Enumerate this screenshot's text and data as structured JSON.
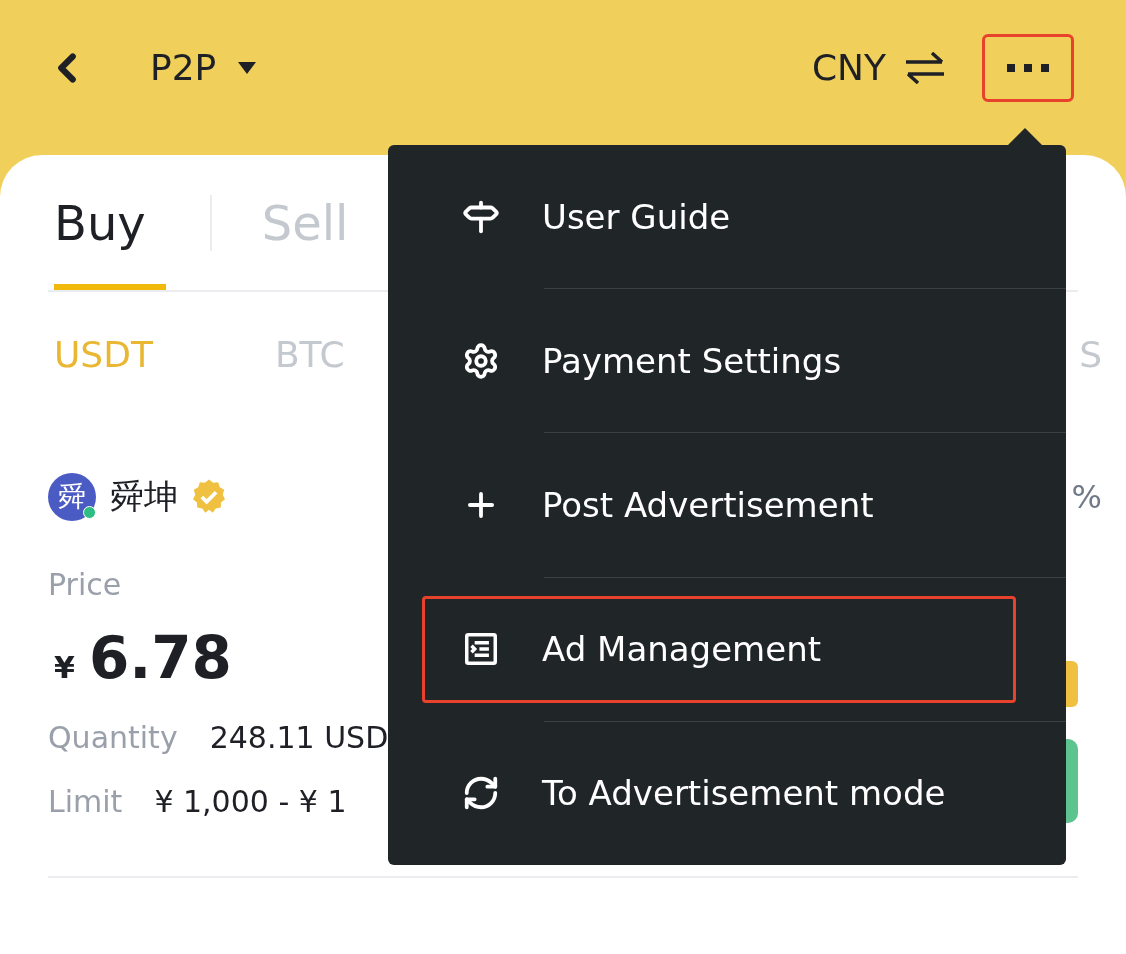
{
  "header": {
    "title": "P2P",
    "currency": "CNY",
    "more_highlighted": true
  },
  "trade_tabs": [
    {
      "label": "Buy",
      "selected": true
    },
    {
      "label": "Sell",
      "selected": false
    }
  ],
  "coin_tabs": [
    {
      "label": "USDT",
      "selected": true
    },
    {
      "label": "BTC",
      "selected": false
    },
    {
      "label": "S",
      "selected": false
    }
  ],
  "listing": {
    "avatar_letter": "舜",
    "online": true,
    "advertiser": "舜坤",
    "verified": true,
    "column_2": "%",
    "price_label": "Price",
    "currency_symbol": "¥",
    "price": "6.78",
    "quantity_label": "Quantity",
    "quantity": "248.11 USD",
    "limit_label": "Limit",
    "limit": "¥ 1,000 - ¥ 1"
  },
  "menu": {
    "items": [
      {
        "kind": "guide",
        "label": "User Guide",
        "highlighted": false
      },
      {
        "kind": "settings",
        "label": "Payment Settings",
        "highlighted": false
      },
      {
        "kind": "post",
        "label": "Post Advertisement",
        "highlighted": false
      },
      {
        "kind": "manage",
        "label": "Ad Management",
        "highlighted": true
      },
      {
        "kind": "switch",
        "label": "To Advertisement mode",
        "highlighted": false
      }
    ]
  }
}
